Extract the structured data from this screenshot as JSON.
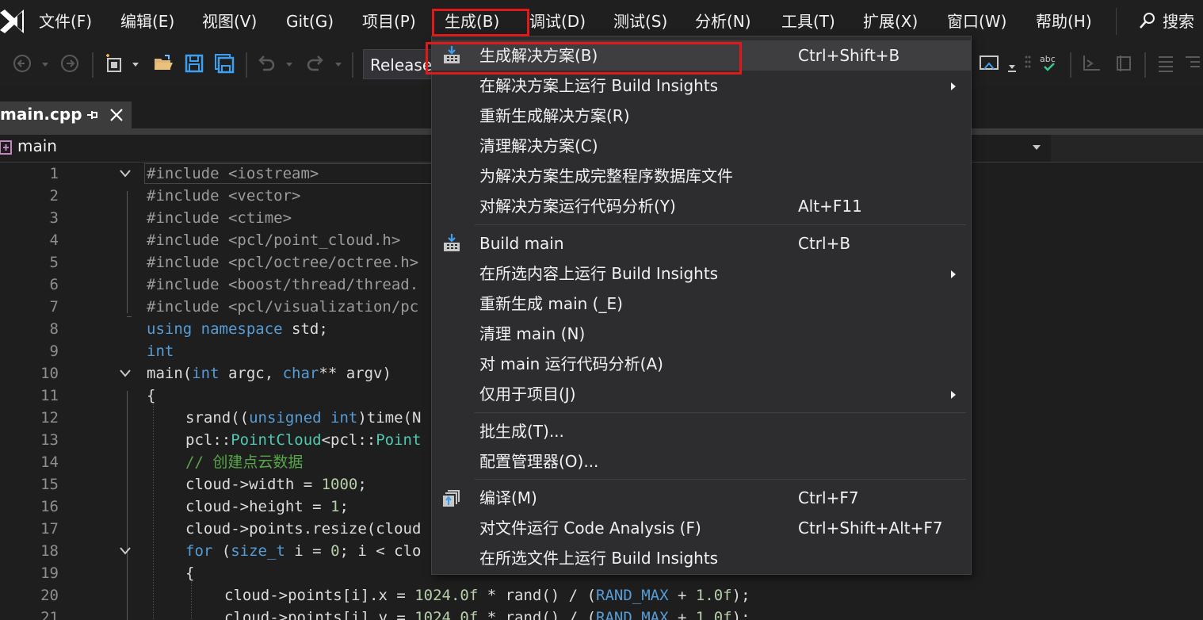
{
  "menubar": {
    "items": [
      "文件(F)",
      "编辑(E)",
      "视图(V)",
      "Git(G)",
      "项目(P)",
      "生成(B)",
      "调试(D)",
      "测试(S)",
      "分析(N)",
      "工具(T)",
      "扩展(X)",
      "窗口(W)",
      "帮助(H)"
    ],
    "search_label": "搜索",
    "active_item": "生成(B)",
    "highlight_color": "#e01a1a"
  },
  "toolbar": {
    "config_value": "Release"
  },
  "tabs": {
    "active_file": "main.cpp"
  },
  "navbar": {
    "scope": "main"
  },
  "editor": {
    "line_numbers": [
      "1",
      "2",
      "3",
      "4",
      "5",
      "6",
      "7",
      "8",
      "9",
      "10",
      "11",
      "12",
      "13",
      "14",
      "15",
      "16",
      "17",
      "18",
      "19",
      "20",
      "21"
    ],
    "line_1": "#include <iostream>",
    "line_2": "#include <vector>",
    "line_3": "#include <ctime>",
    "line_4": "#include <pcl/point_cloud.h>",
    "line_5": "#include <pcl/octree/octree.h>",
    "line_6": "#include <boost/thread/thread.",
    "line_7": "#include <pcl/visualization/pc",
    "line_8a": "using namespace",
    "line_8b": " std;",
    "line_9": "int",
    "line_10a": "main(",
    "line_10b": "int",
    "line_10c": " argc, ",
    "line_10d": "char",
    "line_10e": "** argv)",
    "line_11": "{",
    "line_12a": "srand((",
    "line_12b": "unsigned int",
    "line_12c": ")time(N",
    "line_13a": "pcl::",
    "line_13b": "PointCloud",
    "line_13c": "<pcl::",
    "line_13d": "Point",
    "line_14": "// 创建点云数据",
    "line_15a": "cloud->width = ",
    "line_15b": "1000",
    "line_15c": ";",
    "line_16a": "cloud->height = ",
    "line_16b": "1",
    "line_16c": ";",
    "line_17": "cloud->points.resize(cloud",
    "line_18a": "for",
    "line_18b": " (",
    "line_18c": "size_t",
    "line_18d": " i = ",
    "line_18e": "0",
    "line_18f": "; i < clo",
    "line_19": "{",
    "line_20a": "cloud->points[i].x = ",
    "line_20b": "1024.0f",
    "line_20c": " * rand() / (",
    "line_20d": "RAND_MAX",
    "line_20e": " + ",
    "line_20f": "1.0f",
    "line_20g": ");",
    "line_21a": "cloud->points[i].y = ",
    "line_21b": "1024.0f",
    "line_21c": " * rand() / (",
    "line_21d": "RAND_MAX",
    "line_21e": " + ",
    "line_21f": "1.0f",
    "line_21g": ");"
  },
  "build_menu": {
    "items": [
      {
        "label": "生成解决方案(B)",
        "shortcut": "Ctrl+Shift+B",
        "icon": "build-solution-icon",
        "highlighted": true
      },
      {
        "label": "在解决方案上运行 Build Insights",
        "shortcut": "",
        "submenu": true
      },
      {
        "label": "重新生成解决方案(R)",
        "shortcut": ""
      },
      {
        "label": "清理解决方案(C)",
        "shortcut": ""
      },
      {
        "label": "为解决方案生成完整程序数据库文件",
        "shortcut": ""
      },
      {
        "label": "对解决方案运行代码分析(Y)",
        "shortcut": "Alt+F11"
      },
      {
        "label": "Build main",
        "shortcut": "Ctrl+B",
        "icon": "build-project-icon"
      },
      {
        "label": "在所选内容上运行 Build Insights",
        "shortcut": "",
        "submenu": true
      },
      {
        "label": "重新生成 main (_E)",
        "shortcut": ""
      },
      {
        "label": "清理 main (N)",
        "shortcut": ""
      },
      {
        "label": "对 main 运行代码分析(A)",
        "shortcut": ""
      },
      {
        "label": "仅用于项目(J)",
        "shortcut": "",
        "submenu": true
      },
      {
        "label": "批生成(T)...",
        "shortcut": ""
      },
      {
        "label": "配置管理器(O)...",
        "shortcut": ""
      },
      {
        "label": "编译(M)",
        "shortcut": "Ctrl+F7",
        "icon": "compile-icon"
      },
      {
        "label": "对文件运行 Code Analysis (F)",
        "shortcut": "Ctrl+Shift+Alt+F7"
      },
      {
        "label": "在所选文件上运行 Build Insights",
        "shortcut": ""
      }
    ]
  }
}
